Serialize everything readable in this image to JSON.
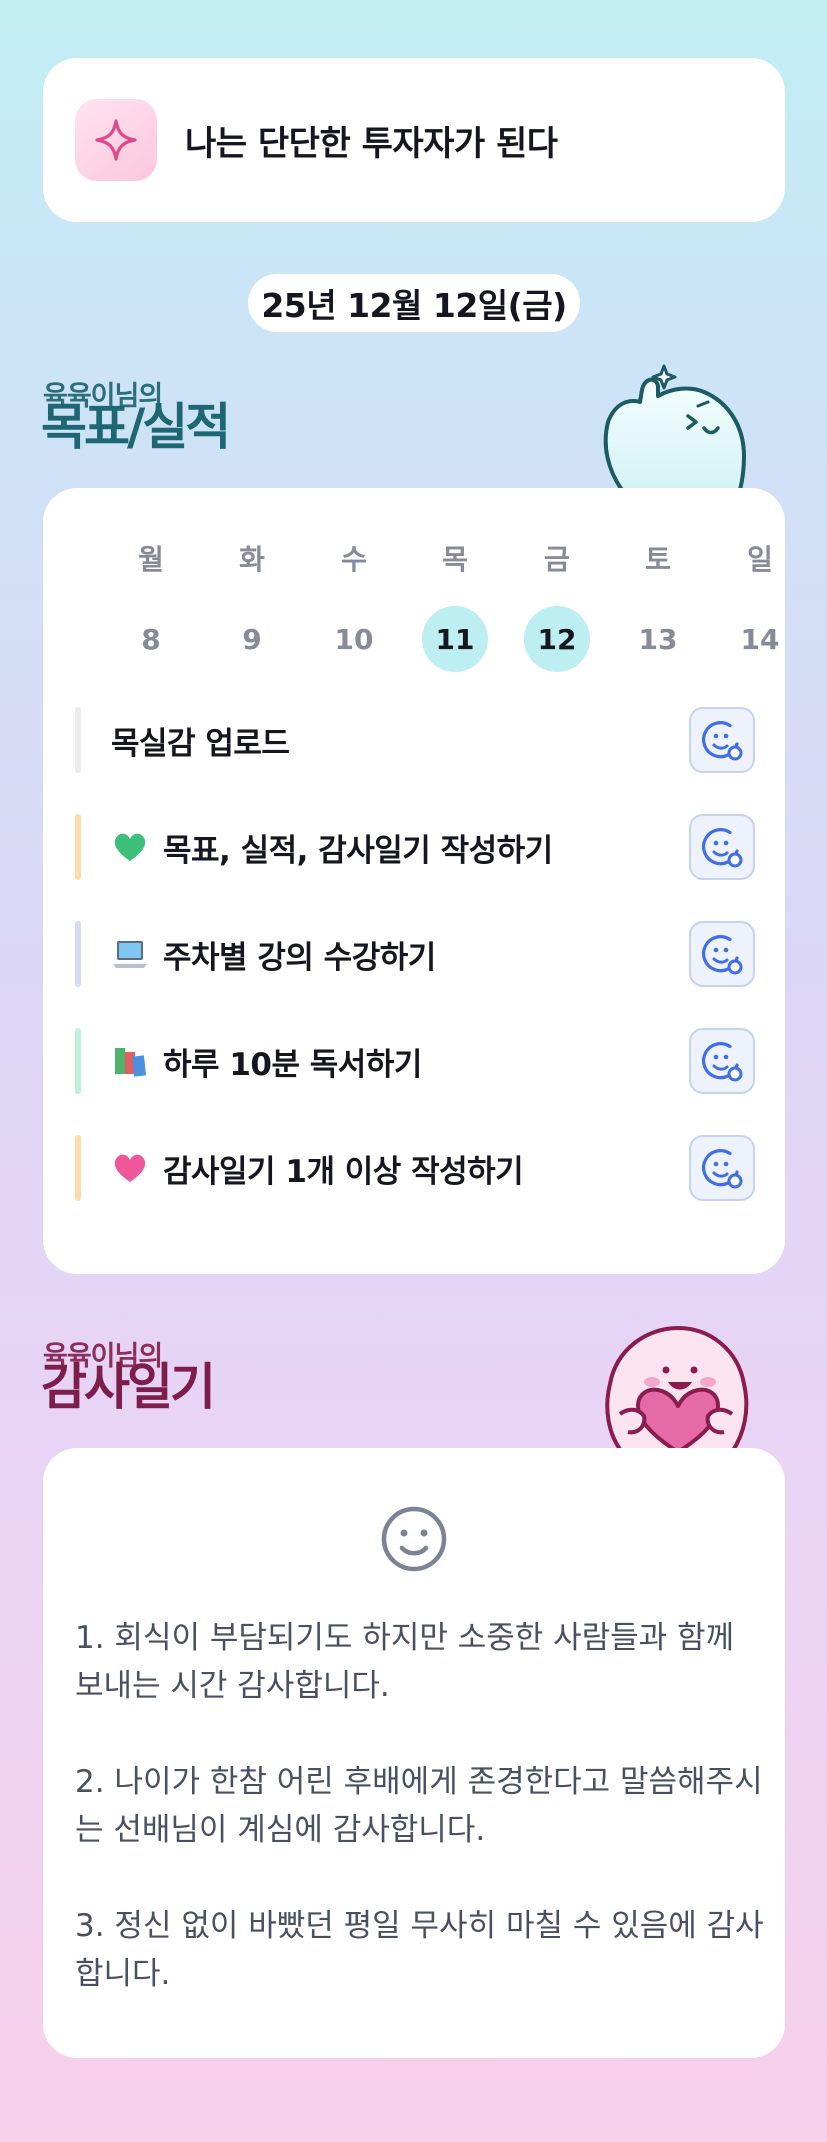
{
  "motto": {
    "text": "나는 단단한 투자자가 된다",
    "icon": "sparkle-icon"
  },
  "date": "25년 12월 12일(금)",
  "goals_section": {
    "owner": "육육이님의",
    "title": "목표/실적"
  },
  "week": [
    {
      "name": "월",
      "num": "8",
      "active": false
    },
    {
      "name": "화",
      "num": "9",
      "active": false
    },
    {
      "name": "수",
      "num": "10",
      "active": false
    },
    {
      "name": "목",
      "num": "11",
      "active": true
    },
    {
      "name": "금",
      "num": "12",
      "active": true
    },
    {
      "name": "토",
      "num": "13",
      "active": false
    },
    {
      "name": "일",
      "num": "14",
      "active": false
    }
  ],
  "tasks": [
    {
      "label": "목실감 업로드",
      "icon": "",
      "bar_color": "#ececef"
    },
    {
      "label": "목표, 실적, 감사일기 작성하기",
      "icon": "green-heart-icon",
      "bar_color": "#fcdcae"
    },
    {
      "label": "주차별 강의 수강하기",
      "icon": "laptop-icon",
      "bar_color": "#d4dcf6"
    },
    {
      "label": "하루 10분 독서하기",
      "icon": "books-icon",
      "bar_color": "#bff0dc"
    },
    {
      "label": "감사일기 1개 이상 작성하기",
      "icon": "pink-heart-icon",
      "bar_color": "#fcdcae"
    }
  ],
  "diary_section": {
    "owner": "육육이님의",
    "title": "감사일기"
  },
  "diary_entries": [
    "1. 회식이 부담되기도 하지만 소중한 사람들과 함께 보내는 시간 감사합니다.",
    "2. 나이가 한참 어린 후배에게 존경한다고 말씀해주시는 선배님이 계심에 감사합니다.",
    "3. 정신 없이 바빴던 평일 무사히 마칠 수 있음에 감사합니다."
  ],
  "colors": {
    "accent_cyan": "#bdeef2",
    "goal_title": "#1d6772",
    "diary_title": "#7c1d4c",
    "reaction_blue": "#3f6ee8"
  }
}
